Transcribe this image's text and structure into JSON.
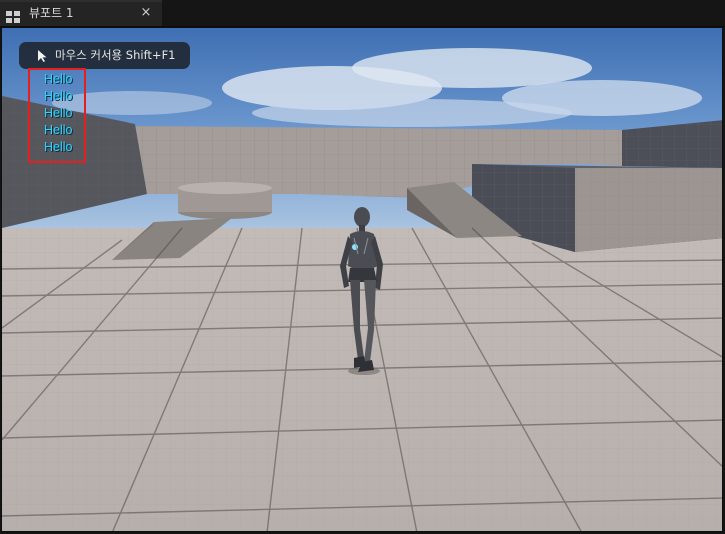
{
  "tab": {
    "label": "뷰포트 1",
    "close_glyph": "×",
    "icon": "viewport-layout-icon"
  },
  "hint": {
    "text": "마우스 커서용 Shift+F1",
    "icon": "cursor-arrow-icon"
  },
  "debug_messages": [
    "Hello",
    "Hello",
    "Hello",
    "Hello",
    "Hello"
  ],
  "colors": {
    "highlight_box": "#e51f1f",
    "message_text": "#2fd3ff",
    "tab_background": "#242424"
  }
}
